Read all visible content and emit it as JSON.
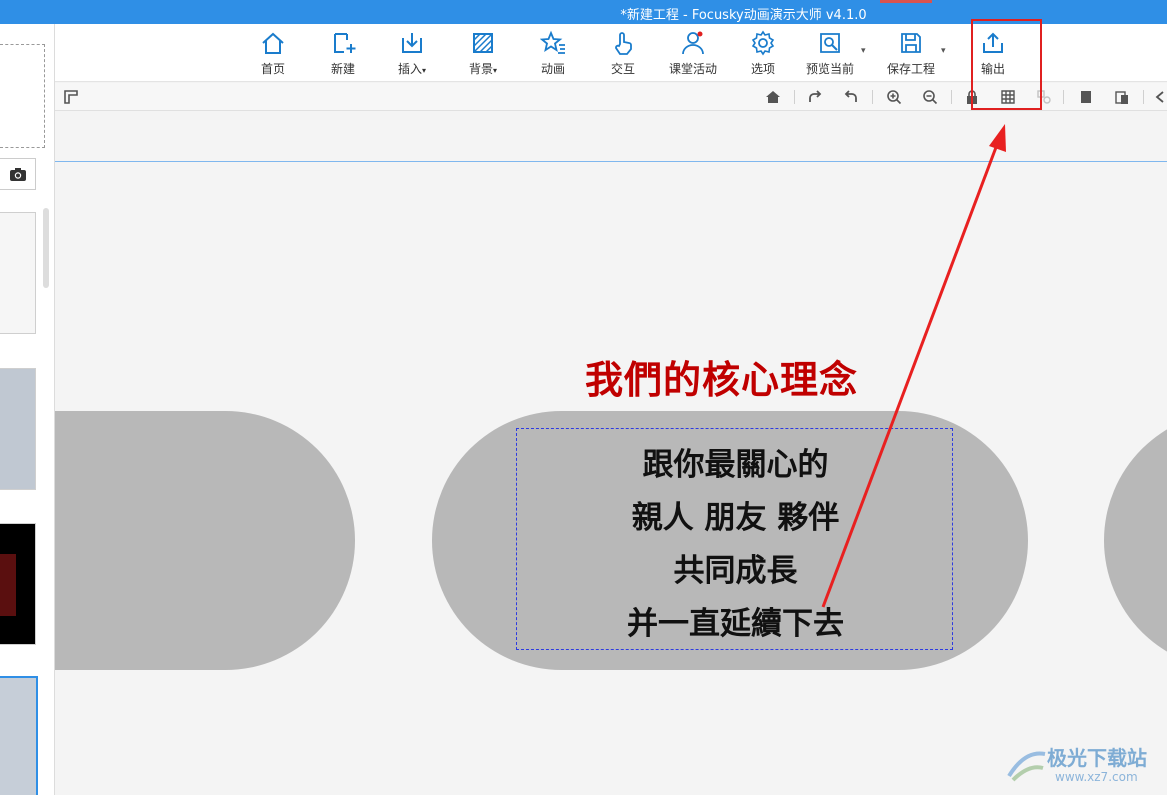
{
  "window": {
    "title": "*新建工程 - Focusky动画演示大师  v4.1.0"
  },
  "toolbar": {
    "items": [
      {
        "label": "首页",
        "icon": "home-icon"
      },
      {
        "label": "新建",
        "icon": "new-slide-icon"
      },
      {
        "label": "插入",
        "icon": "insert-icon",
        "caret": "▾"
      },
      {
        "label": "背景",
        "icon": "background-icon",
        "caret": "▾"
      },
      {
        "label": "动画",
        "icon": "animation-icon"
      },
      {
        "label": "交互",
        "icon": "interaction-icon"
      },
      {
        "label": "课堂活动",
        "icon": "classroom-activity-icon"
      },
      {
        "label": "选项",
        "icon": "settings-icon"
      },
      {
        "label": "预览当前",
        "icon": "preview-icon"
      },
      {
        "label": "保存工程",
        "icon": "save-icon"
      },
      {
        "label": "输出",
        "icon": "export-icon"
      }
    ]
  },
  "canvas": {
    "heading": "我們的核心理念",
    "lines": [
      "跟你最關心的",
      "親人 朋友 夥伴",
      "共同成長",
      "并一直延續下去"
    ]
  },
  "watermark": {
    "name": "极光下载站",
    "url": "www.xz7.com"
  },
  "colors": {
    "accent": "#2f8fe6",
    "heading": "#c00000",
    "highlight": "#e02020"
  }
}
